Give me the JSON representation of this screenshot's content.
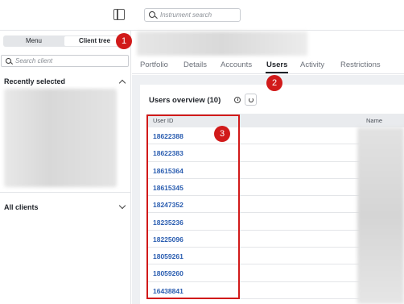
{
  "topbar": {
    "search_placeholder": "Instrument search"
  },
  "sidebar": {
    "menu_label": "Menu",
    "client_tree_label": "Client tree",
    "search_placeholder": "Search client",
    "recently_selected_label": "Recently selected",
    "all_clients_label": "All clients"
  },
  "tabs": [
    {
      "label": "Portfolio",
      "active": false
    },
    {
      "label": "Details",
      "active": false
    },
    {
      "label": "Accounts",
      "active": false
    },
    {
      "label": "Users",
      "active": true
    },
    {
      "label": "Activity",
      "active": false
    },
    {
      "label": "Restrictions",
      "active": false
    }
  ],
  "users_overview": {
    "title": "Users overview (10)",
    "columns": [
      "User ID",
      "Name"
    ],
    "user_ids": [
      "18622388",
      "18622383",
      "18615364",
      "18615345",
      "18247352",
      "18235236",
      "18225096",
      "18059261",
      "18059260",
      "16438841"
    ]
  },
  "annotations": [
    "1",
    "2",
    "3"
  ],
  "colors": {
    "annotation_red": "#d11a1a",
    "link_blue": "#2a5db0",
    "header_bg": "#e9ebee"
  }
}
